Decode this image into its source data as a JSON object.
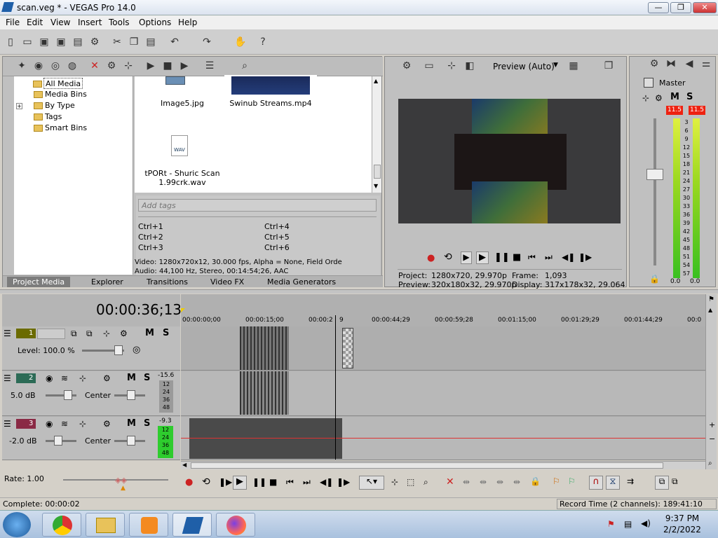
{
  "window": {
    "title": "scan.veg * - VEGAS Pro 14.0",
    "min": "—",
    "max": "❐",
    "close": "✕"
  },
  "menu": [
    "File",
    "Edit",
    "View",
    "Insert",
    "Tools",
    "Options",
    "Help"
  ],
  "tree": {
    "items": [
      "All Media",
      "Media Bins",
      "By Type",
      "Tags",
      "Smart Bins"
    ]
  },
  "files": [
    {
      "name": "Image5.jpg"
    },
    {
      "name": "Swinub Streams.mp4"
    },
    {
      "name": "tPORt - Shuric Scan 1.99crk.wav",
      "line1": "tPORt - Shuric Scan",
      "line2": "1.99crk.wav",
      "badge": "WAV"
    }
  ],
  "tags": {
    "placeholder": "Add tags",
    "shortcuts": [
      "Ctrl+1",
      "Ctrl+4",
      "Ctrl+2",
      "Ctrl+5",
      "Ctrl+3",
      "Ctrl+6"
    ]
  },
  "info": {
    "video": "Video: 1280x720x12, 30.000 fps, Alpha = None, Field Orde",
    "audio": "Audio: 44,100 Hz, Stereo, 00:14:54;26, AAC"
  },
  "panel_tabs": [
    "Project Media",
    "Explorer",
    "Transitions",
    "Video FX",
    "Media Generators"
  ],
  "preview": {
    "mode": "Preview (Auto)",
    "project_label": "Project:",
    "project": "1280x720, 29.970p",
    "frame_label": "Frame:",
    "frame": "1,093",
    "preview_label": "Preview:",
    "preview": "320x180x32, 29.970p",
    "display_label": "Display:",
    "display": "317x178x32, 29.064"
  },
  "master": {
    "label": "Master",
    "peak_l": "11.5",
    "peak_r": "11.5",
    "scale": [
      "3",
      "6",
      "9",
      "12",
      "15",
      "18",
      "21",
      "24",
      "27",
      "30",
      "33",
      "36",
      "39",
      "42",
      "45",
      "48",
      "51",
      "54",
      "57"
    ],
    "bottom_l": "0.0",
    "bottom_r": "0.0"
  },
  "timeline": {
    "timecode": "00:00:36;13",
    "ruler": [
      "00:00:00;00",
      "00:00:15;00",
      "00:00:2",
      "9",
      "00:00:44;29",
      "00:00:59;28",
      "00:01:15;00",
      "00:01:29;29",
      "00:01:44;29",
      "00:0"
    ]
  },
  "tracks": [
    {
      "num": "1",
      "level": "Level: 100.0 %",
      "color": "#6b6b00"
    },
    {
      "num": "2",
      "vol": "5.0 dB",
      "pan": "Center",
      "meter": "-15.6",
      "color": "#2c6b56"
    },
    {
      "num": "3",
      "vol": "-2.0 dB",
      "pan": "Center",
      "meter": "-9.3",
      "color": "#8a2a45"
    }
  ],
  "track_meter_scale": [
    "12",
    "24",
    "36",
    "48"
  ],
  "rate": "Rate: 1.00",
  "status": {
    "complete": "Complete: 00:00:02",
    "record": "Record Time (2 channels): 189:41:10"
  },
  "clock": {
    "time": "9:37 PM",
    "date": "2/2/2022"
  }
}
